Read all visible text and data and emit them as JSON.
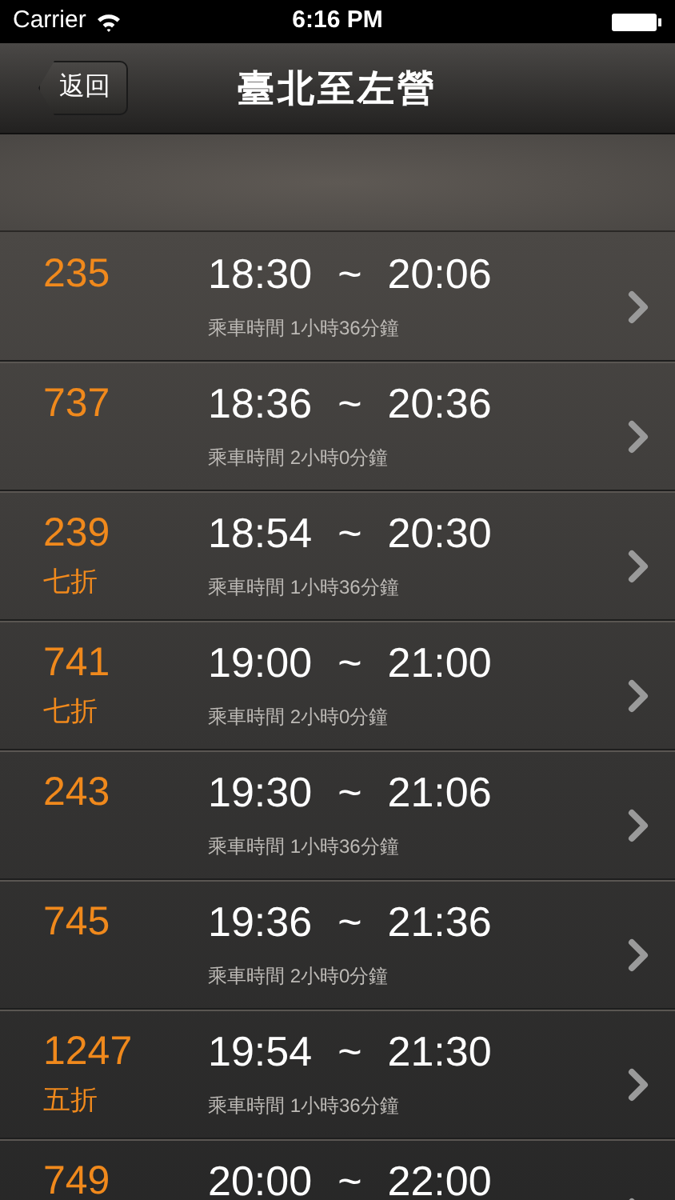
{
  "status_bar": {
    "carrier": "Carrier",
    "time": "6:16 PM"
  },
  "nav": {
    "back": "返回",
    "title": "臺北至左營"
  },
  "trips": [
    {
      "train": "235",
      "depart": "18:30",
      "separator": "~",
      "arrive": "20:06",
      "duration": "乘車時間 1小時36分鐘"
    },
    {
      "train": "737",
      "depart": "18:36",
      "separator": "~",
      "arrive": "20:36",
      "duration": "乘車時間 2小時0分鐘"
    },
    {
      "train": "239",
      "discount": "七折",
      "depart": "18:54",
      "separator": "~",
      "arrive": "20:30",
      "duration": "乘車時間 1小時36分鐘"
    },
    {
      "train": "741",
      "discount": "七折",
      "depart": "19:00",
      "separator": "~",
      "arrive": "21:00",
      "duration": "乘車時間 2小時0分鐘"
    },
    {
      "train": "243",
      "depart": "19:30",
      "separator": "~",
      "arrive": "21:06",
      "duration": "乘車時間 1小時36分鐘"
    },
    {
      "train": "745",
      "depart": "19:36",
      "separator": "~",
      "arrive": "21:36",
      "duration": "乘車時間 2小時0分鐘"
    },
    {
      "train": "1247",
      "discount": "五折",
      "depart": "19:54",
      "separator": "~",
      "arrive": "21:30",
      "duration": "乘車時間 1小時36分鐘"
    },
    {
      "train": "749",
      "depart": "20:00",
      "separator": "~",
      "arrive": "22:00"
    }
  ]
}
